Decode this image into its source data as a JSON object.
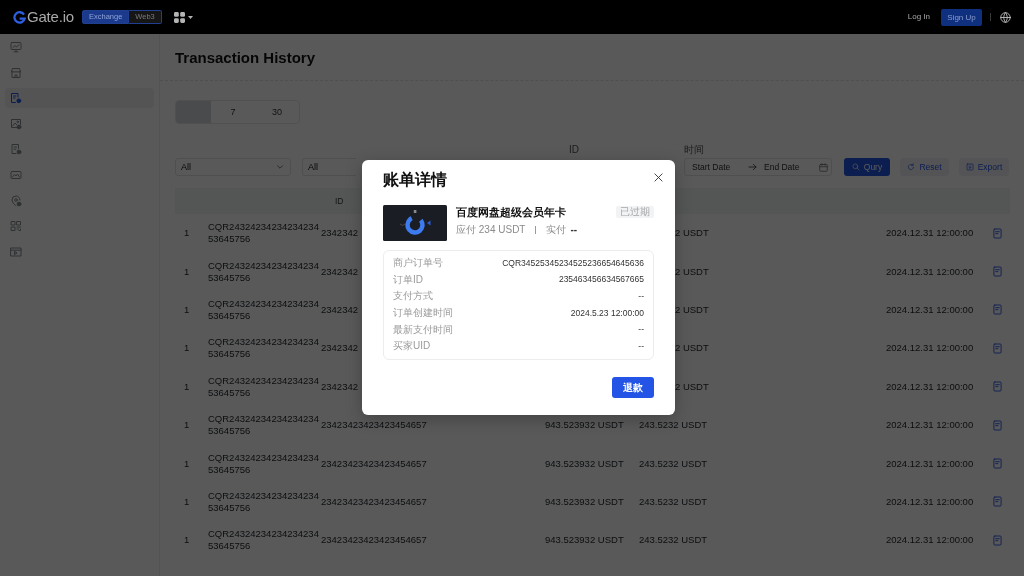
{
  "header": {
    "brand": "Gate.io",
    "modes": [
      {
        "label": "Exchange",
        "selected": true
      },
      {
        "label": "Web3",
        "selected": false
      }
    ],
    "login": "Log In",
    "signup": "Sign Up"
  },
  "sidebar": {
    "items": [
      {
        "selected": false
      },
      {
        "selected": false
      },
      {
        "selected": true
      },
      {
        "selected": false
      },
      {
        "selected": false
      },
      {
        "selected": false
      },
      {
        "selected": false
      },
      {
        "selected": false
      },
      {
        "selected": false
      }
    ]
  },
  "page": {
    "title": "Transaction History"
  },
  "period_tabs": [
    {
      "selected": true
    },
    {
      "label": "7",
      "selected": false
    },
    {
      "label": "30",
      "selected": false
    }
  ],
  "filters": {
    "selects": [
      {
        "value": "All"
      },
      {
        "value": "All"
      }
    ],
    "id_label": "ID",
    "time_label": "时间",
    "date_range": {
      "start": {
        "placeholder": "Start Date"
      },
      "end": {
        "placeholder": "End Date"
      }
    },
    "buttons": [
      {
        "kind": "query",
        "label": "Qury"
      },
      {
        "kind": "reset",
        "label": "Reset"
      },
      {
        "kind": "export",
        "label": "Export"
      }
    ]
  },
  "table": {
    "header": {
      "column_3": "ID"
    },
    "rows": [
      {
        "column_1": "1",
        "column_2": "CQR2432423423423423453645756",
        "column_3": "2342342",
        "column_5": "2 USDT",
        "column_6": "2024.12.31 12:00:00"
      },
      {
        "column_1": "1",
        "column_2": "CQR2432423423423423453645756",
        "column_3": "2342342",
        "column_5": "2 USDT",
        "column_6": "2024.12.31 12:00:00"
      },
      {
        "column_1": "1",
        "column_2": "CQR2432423423423423453645756",
        "column_3": "2342342",
        "column_5": "2 USDT",
        "column_6": "2024.12.31 12:00:00"
      },
      {
        "column_1": "1",
        "column_2": "CQR2432423423423423453645756",
        "column_3": "2342342",
        "column_5": "2 USDT",
        "column_6": "2024.12.31 12:00:00"
      },
      {
        "column_1": "1",
        "column_2": "CQR2432423423423423453645756",
        "column_3": "2342342",
        "column_5": "2 USDT",
        "column_6": "2024.12.31 12:00:00"
      },
      {
        "column_1": "1",
        "column_2": "CQR2432423423423423453645756",
        "column_3": "23423423423423454657",
        "column_4": "943.523932 USDT",
        "column_5": "243.5232 USDT",
        "column_6": "2024.12.31 12:00:00"
      },
      {
        "column_1": "1",
        "column_2": "CQR2432423423423423453645756",
        "column_3": "23423423423423454657",
        "column_4": "943.523932 USDT",
        "column_5": "243.5232 USDT",
        "column_6": "2024.12.31 12:00:00"
      },
      {
        "column_1": "1",
        "column_2": "CQR2432423423423423453645756",
        "column_3": "23423423423423454657",
        "column_4": "943.523932 USDT",
        "column_5": "243.5232 USDT",
        "column_6": "2024.12.31 12:00:00"
      },
      {
        "column_1": "1",
        "column_2": "CQR2432423423423423453645756",
        "column_3": "23423423423423454657",
        "column_4": "943.523932 USDT",
        "column_5": "243.5232 USDT",
        "column_6": "2024.12.31 12:00:00"
      }
    ]
  },
  "dialog": {
    "title": "账单详情",
    "product": {
      "name": "百度网盘超级会员年卡",
      "status": "已过期",
      "payable": "应付 234 USDT",
      "paid_label": "实付",
      "paid_value": "--"
    },
    "details": [
      {
        "label": "商户订单号",
        "value": "CQR34525345234525236654645636"
      },
      {
        "label": "订单ID",
        "value": "235463456634567665"
      },
      {
        "label": "支付方式",
        "value": "--"
      },
      {
        "label": "订单创建时间",
        "value": "2024.5.23 12:00:00"
      },
      {
        "label": "最新支付时间",
        "value": "--"
      },
      {
        "label": "买家UID",
        "value": "--"
      }
    ],
    "button": "退款"
  }
}
